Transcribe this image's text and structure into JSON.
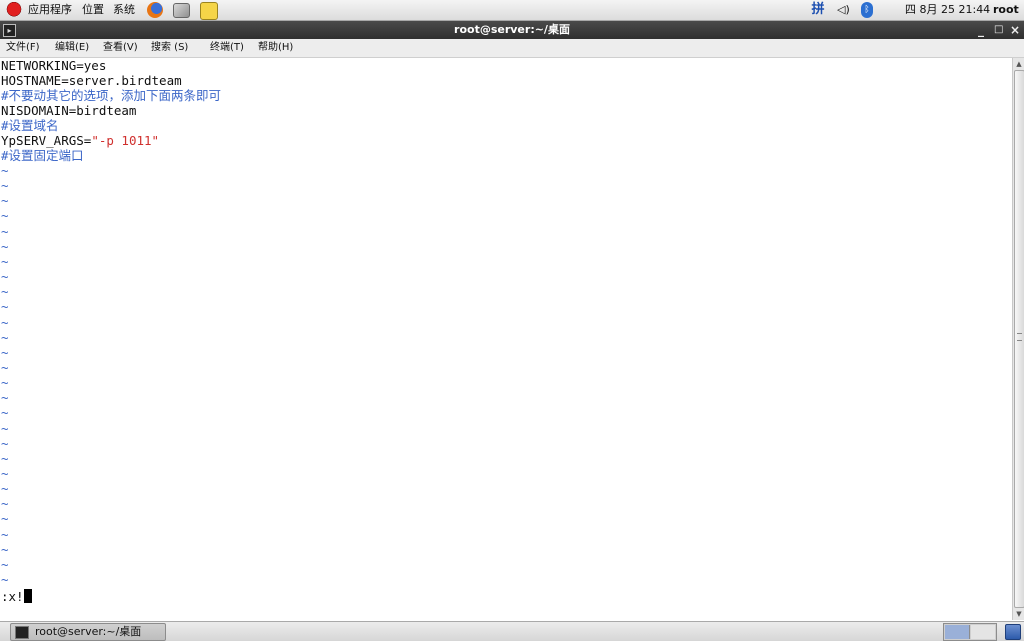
{
  "top_panel": {
    "menus": [
      "应用程序",
      "位置",
      "系统"
    ],
    "ime": "拼",
    "clock": "四 8月 25 21:44",
    "user": "root",
    "icons": [
      "redhat-icon",
      "firefox-icon",
      "email-icon",
      "notes-icon",
      "volume-icon",
      "bluetooth-icon"
    ]
  },
  "window": {
    "title": "root@server:~/桌面",
    "minimize": "_",
    "maximize": "□",
    "close": "×"
  },
  "menubar": [
    "文件(F)",
    "编辑(E)",
    "查看(V)",
    "搜索 (S)",
    "终端(T)",
    "帮助(H)"
  ],
  "terminal": {
    "lines": [
      {
        "text": "NETWORKING=yes"
      },
      {
        "text": "HOSTNAME=server.birdteam"
      },
      {
        "text": "#不要动其它的选项，添加下面两条即可",
        "type": "comment"
      },
      {
        "text": "NISDOMAIN=birdteam"
      },
      {
        "text": "#设置域名",
        "type": "comment"
      },
      {
        "key": "YpSERV_ARGS=",
        "value": "\"-p 1011\""
      },
      {
        "text": "#设置固定端口",
        "type": "comment"
      }
    ],
    "tilde": "~",
    "tilde_count": 28,
    "command": ":x!"
  },
  "bottom_panel": {
    "task_label": "root@server:~/桌面"
  },
  "colors": {
    "comment": "#3c67c8",
    "string": "#d0302e",
    "titlebar": "#3a3a3a"
  }
}
